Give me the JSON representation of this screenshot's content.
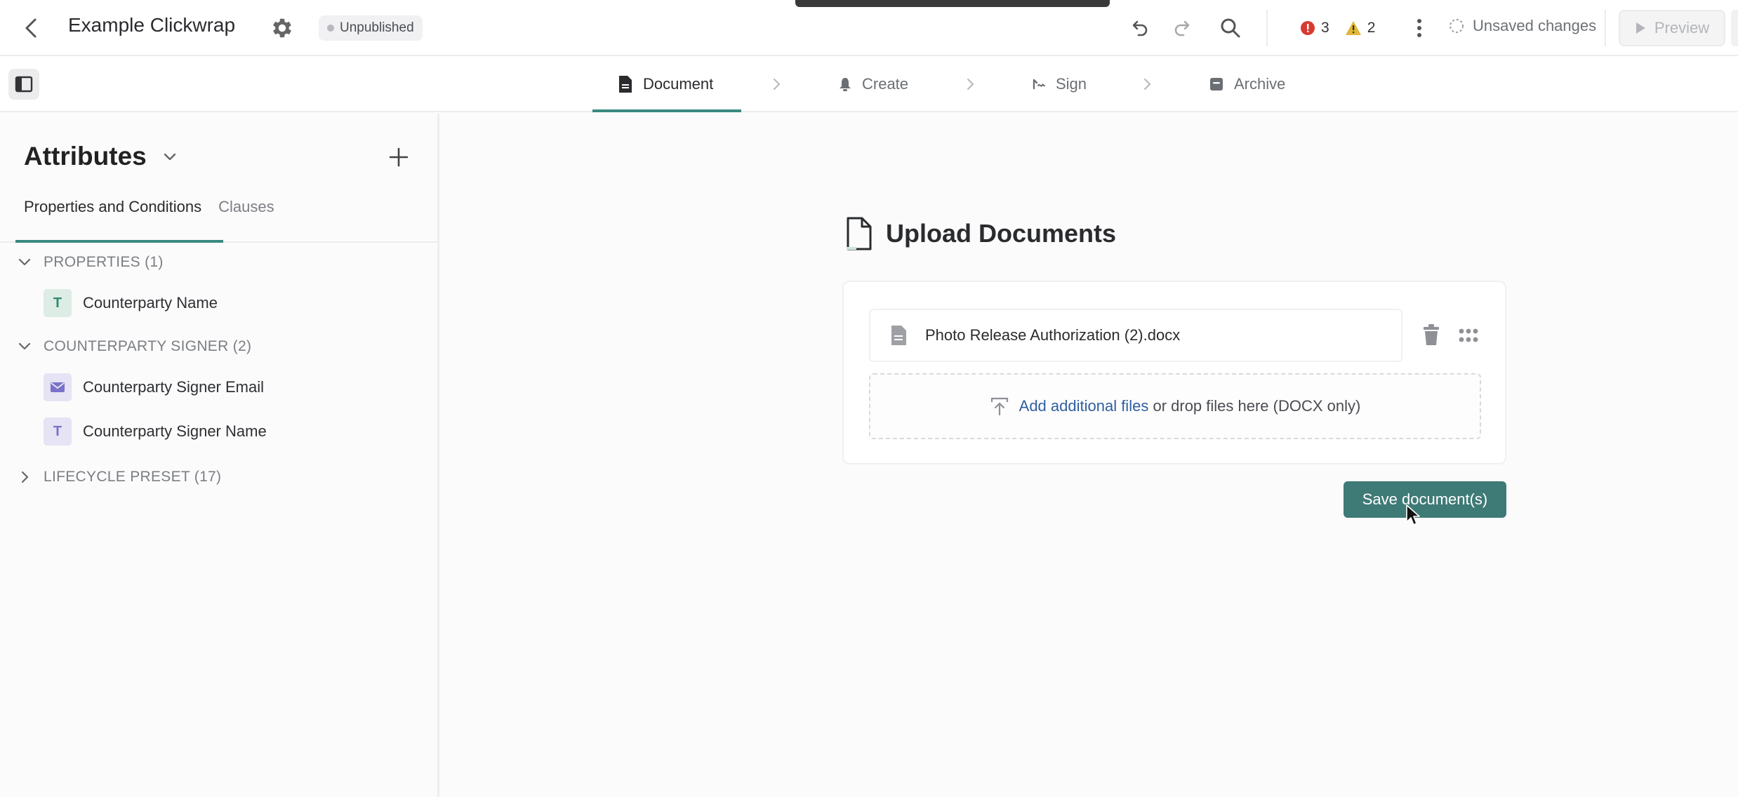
{
  "header": {
    "title": "Example Clickwrap",
    "status": "Unpublished",
    "errors_count": "3",
    "warnings_count": "2",
    "save_status": "Unsaved changes",
    "preview_label": "Preview"
  },
  "steps": [
    {
      "label": "Document",
      "icon": "document-icon",
      "active": true
    },
    {
      "label": "Create",
      "icon": "bell-icon",
      "active": false
    },
    {
      "label": "Sign",
      "icon": "signature-icon",
      "active": false
    },
    {
      "label": "Archive",
      "icon": "archive-icon",
      "active": false
    }
  ],
  "sidebar": {
    "title": "Attributes",
    "tabs": [
      "Properties and Conditions",
      "Clauses"
    ],
    "groups": [
      {
        "label": "PROPERTIES (1)",
        "expanded": true,
        "items": [
          {
            "label": "Counterparty Name",
            "type_icon": "T"
          }
        ]
      },
      {
        "label": "COUNTERPARTY SIGNER (2)",
        "expanded": true,
        "items": [
          {
            "label": "Counterparty Signer Email",
            "type_icon": "envelope-icon"
          },
          {
            "label": "Counterparty Signer Name",
            "type_icon": "T"
          }
        ]
      },
      {
        "label": "LIFECYCLE PRESET (17)",
        "expanded": false,
        "items": []
      }
    ]
  },
  "main": {
    "heading": "Upload Documents",
    "file_name": "Photo Release Authorization (2).docx",
    "dropzone_link": "Add additional files",
    "dropzone_text": "or drop files here (DOCX only)",
    "save_button": "Save document(s)"
  },
  "colors": {
    "accent": "#3b8a7e",
    "save_button": "#3e7a76",
    "error": "#d63b2f",
    "warning": "#e0b73a",
    "link": "#2f5f9e"
  }
}
